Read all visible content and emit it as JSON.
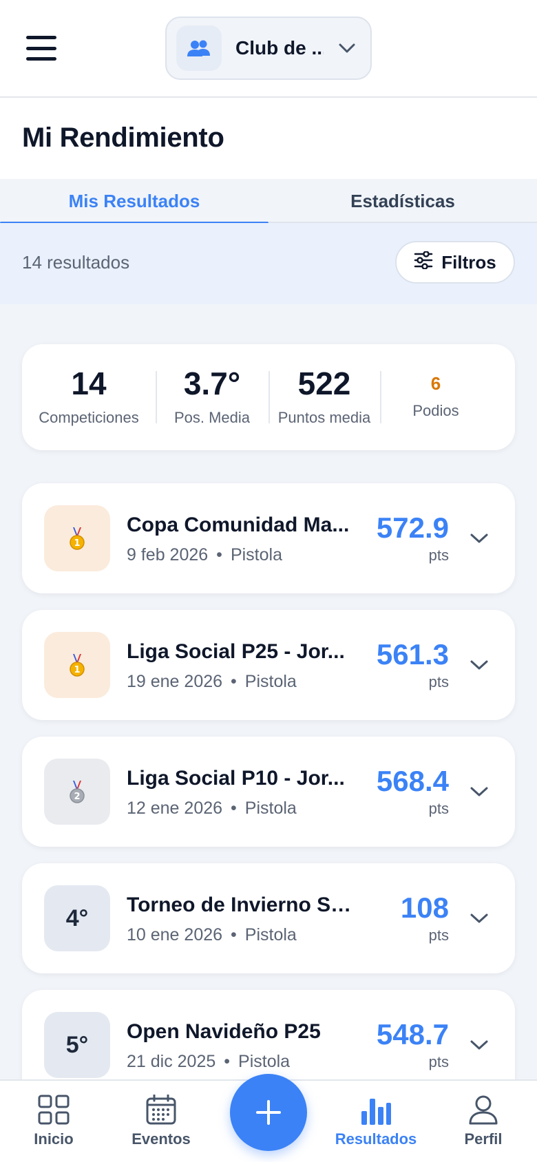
{
  "header": {
    "club_name": "Club de ..."
  },
  "page": {
    "title": "Mi Rendimiento"
  },
  "tabs": [
    {
      "label": "Mis Resultados",
      "active": true
    },
    {
      "label": "Estadísticas",
      "active": false
    }
  ],
  "filterbar": {
    "count_text": "14 resultados",
    "filter_label": "Filtros"
  },
  "stats": [
    {
      "value": "14",
      "label": "Competiciones"
    },
    {
      "value": "3.7°",
      "label": "Pos. Media"
    },
    {
      "value": "522",
      "label": "Puntos media"
    },
    {
      "value": "6",
      "label": "Podios"
    }
  ],
  "results": [
    {
      "position": "1",
      "badge": "gold-medal-icon",
      "name": "Copa Comunidad Ma...",
      "date": "9 feb 2026",
      "discipline": "Pistola",
      "score": "572.9",
      "unit": "pts"
    },
    {
      "position": "1",
      "badge": "gold-medal-icon",
      "name": "Liga Social P25 - Jor...",
      "date": "19 ene 2026",
      "discipline": "Pistola",
      "score": "561.3",
      "unit": "pts"
    },
    {
      "position": "2",
      "badge": "silver-medal-icon",
      "name": "Liga Social P10 - Jor...",
      "date": "12 ene 2026",
      "discipline": "Pistola",
      "score": "568.4",
      "unit": "pts"
    },
    {
      "position": "4°",
      "badge": "",
      "name": "Torneo de Invierno Skeet",
      "date": "10 ene 2026",
      "discipline": "Pistola",
      "score": "108",
      "unit": "pts"
    },
    {
      "position": "5°",
      "badge": "",
      "name": "Open Navideño P25",
      "date": "21 dic 2025",
      "discipline": "Pistola",
      "score": "548.7",
      "unit": "pts"
    }
  ],
  "bottom_nav": [
    {
      "label": "Inicio",
      "icon": "grid-icon"
    },
    {
      "label": "Eventos",
      "icon": "calendar-icon"
    },
    {
      "label": "Resultados",
      "icon": "bar-chart-icon",
      "active": true
    },
    {
      "label": "Perfil",
      "icon": "user-icon"
    }
  ],
  "colors": {
    "accent": "#3b82f6",
    "podium": "#d97706",
    "gold_badge_bg": "#fbebdc",
    "silver_badge_bg": "#e9ebef"
  }
}
